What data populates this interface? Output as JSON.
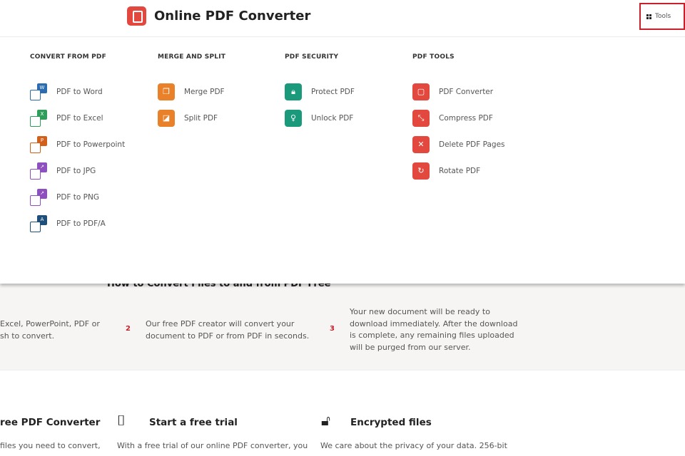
{
  "header": {
    "brand": "Online PDF Converter",
    "tools_label": "Tools"
  },
  "menu": {
    "columns": [
      {
        "title": "CONVERT FROM PDF",
        "items": [
          {
            "label": "PDF to Word",
            "icon": "word-doc-icon",
            "color": "#2b6cb0",
            "badge": "W"
          },
          {
            "label": "PDF to Excel",
            "icon": "excel-doc-icon",
            "color": "#2f9e5a",
            "badge": "X"
          },
          {
            "label": "PDF to Powerpoint",
            "icon": "powerpoint-doc-icon",
            "color": "#d2601a",
            "badge": "P"
          },
          {
            "label": "PDF to JPG",
            "icon": "jpg-doc-icon",
            "color": "#8e4fbf",
            "badge": "↗"
          },
          {
            "label": "PDF to PNG",
            "icon": "png-doc-icon",
            "color": "#8e4fbf",
            "badge": "↗"
          },
          {
            "label": "PDF to PDF/A",
            "icon": "pdfa-doc-icon",
            "color": "#1d4f7a",
            "badge": "A"
          }
        ]
      },
      {
        "title": "MERGE AND SPLIT",
        "items": [
          {
            "label": "Merge PDF",
            "icon": "merge-icon",
            "color": "#e8812a",
            "glyph": "❐"
          },
          {
            "label": "Split PDF",
            "icon": "split-icon",
            "color": "#e8812a",
            "glyph": "◪"
          }
        ]
      },
      {
        "title": "PDF SECURITY",
        "items": [
          {
            "label": "Protect PDF",
            "icon": "lock-icon",
            "color": "#1a9a7a",
            "glyph": "🔒︎"
          },
          {
            "label": "Unlock PDF",
            "icon": "key-icon",
            "color": "#1a9a7a",
            "glyph": "♀"
          }
        ]
      },
      {
        "title": "PDF TOOLS",
        "items": [
          {
            "label": "PDF Converter",
            "icon": "pdf-converter-icon",
            "color": "#e2483d",
            "glyph": "▢"
          },
          {
            "label": "Compress PDF",
            "icon": "compress-icon",
            "color": "#e2483d",
            "glyph": "⤡"
          },
          {
            "label": "Delete PDF Pages",
            "icon": "delete-icon",
            "color": "#e2483d",
            "glyph": "✕"
          },
          {
            "label": "Rotate PDF",
            "icon": "rotate-icon",
            "color": "#e2483d",
            "glyph": "↻"
          }
        ]
      }
    ]
  },
  "how": {
    "title": "How to Convert Files to and from PDF Free",
    "steps": [
      {
        "num": "",
        "lines": [
          "Excel, PowerPoint, PDF or",
          "sh to convert."
        ]
      },
      {
        "num": "2",
        "lines": [
          "Our free PDF creator will convert your",
          "document to PDF or from PDF in seconds."
        ]
      },
      {
        "num": "3",
        "lines": [
          "Your new document will be ready to",
          "download immediately. After the download",
          "is complete, any remaining files uploaded",
          "will be purged from our server."
        ]
      }
    ]
  },
  "features": [
    {
      "title": "ree PDF Converter",
      "text": "files you need to convert,"
    },
    {
      "title": "Start a free trial",
      "text": "With a free trial of our online PDF converter, you"
    },
    {
      "title": "Encrypted files",
      "text": "We care about the privacy of your data. 256-bit"
    }
  ],
  "colors": {
    "accent": "#e2483d",
    "highlight": "#c8202a"
  }
}
